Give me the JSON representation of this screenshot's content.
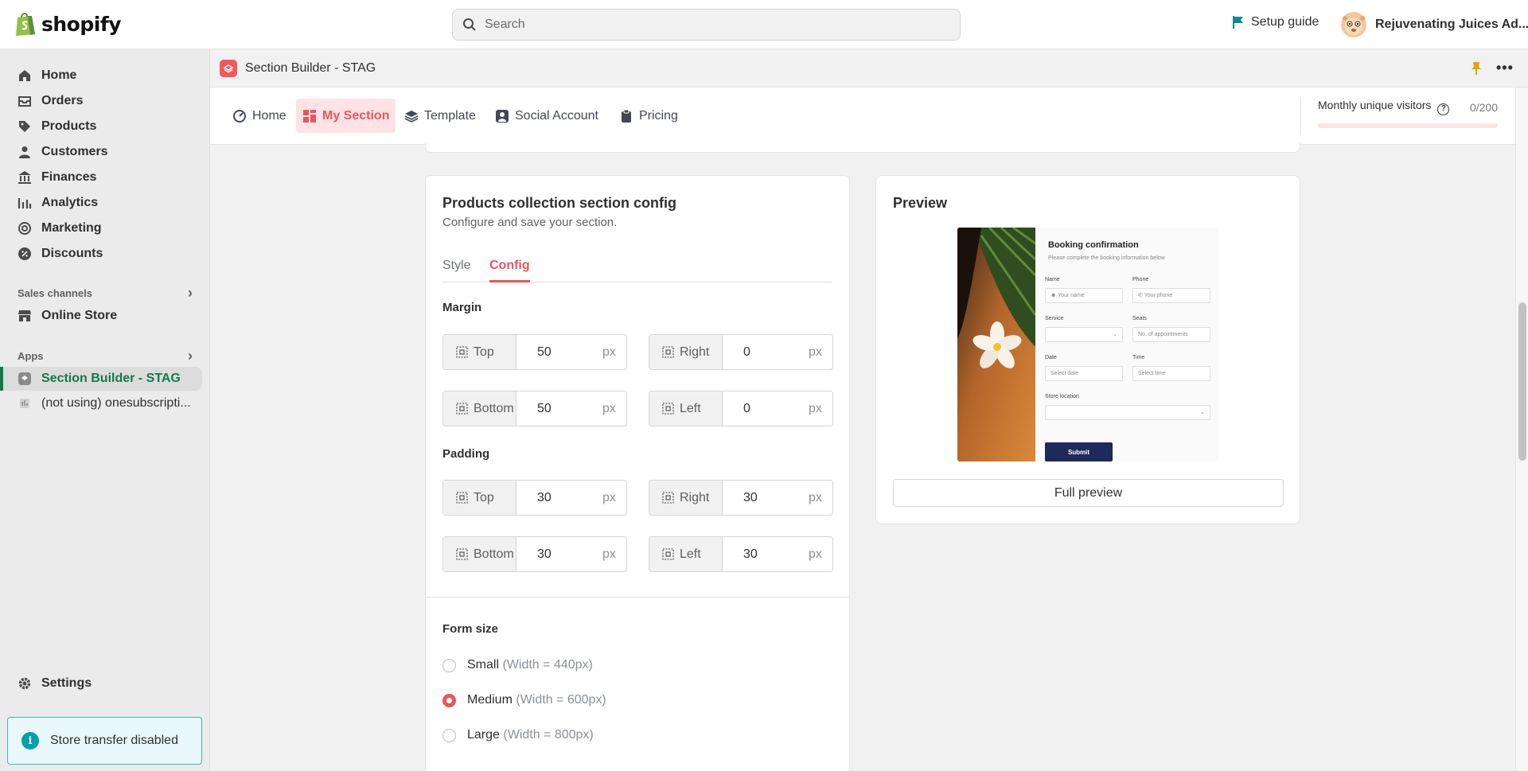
{
  "brand": {
    "name": "shopify",
    "color": "#5e8e3e"
  },
  "search": {
    "placeholder": "Search"
  },
  "header": {
    "setup_guide": "Setup guide",
    "account_name": "Rejuvenating Juices Ad..."
  },
  "sidebar": {
    "items": [
      {
        "label": "Home",
        "icon": "home-icon"
      },
      {
        "label": "Orders",
        "icon": "orders-icon"
      },
      {
        "label": "Products",
        "icon": "tag-icon"
      },
      {
        "label": "Customers",
        "icon": "person-icon"
      },
      {
        "label": "Finances",
        "icon": "bank-icon"
      },
      {
        "label": "Analytics",
        "icon": "chart-bars-icon"
      },
      {
        "label": "Marketing",
        "icon": "target-icon"
      },
      {
        "label": "Discounts",
        "icon": "discount-icon"
      }
    ],
    "sales_channels_label": "Sales channels",
    "online_store": "Online Store",
    "apps_label": "Apps",
    "apps": [
      {
        "label": "Section Builder - STAG"
      },
      {
        "label": "(not using) onesubscripti..."
      }
    ],
    "settings": "Settings",
    "transfer_notice": "Store transfer disabled",
    "active_color": "#107a4d"
  },
  "app_bar": {
    "title": "Section Builder - STAG"
  },
  "app_tabs": [
    {
      "label": "Home",
      "icon": "gauge-icon"
    },
    {
      "label": "My Section",
      "icon": "grid-icon"
    },
    {
      "label": "Template",
      "icon": "layers-icon"
    },
    {
      "label": "Social Account",
      "icon": "person-square-icon"
    },
    {
      "label": "Pricing",
      "icon": "clipboard-icon"
    }
  ],
  "visitors": {
    "label": "Monthly unique visitors",
    "count": "0/200",
    "fraction": 0
  },
  "config": {
    "title": "Products collection section config",
    "subtitle": "Configure and save your section.",
    "tabs": [
      "Style",
      "Config"
    ],
    "active_tab": "Config",
    "margin_label": "Margin",
    "padding_label": "Padding",
    "unit": "px",
    "margin": [
      {
        "side": "Top",
        "value": "50"
      },
      {
        "side": "Right",
        "value": "0"
      },
      {
        "side": "Bottom",
        "value": "50"
      },
      {
        "side": "Left",
        "value": "0"
      }
    ],
    "padding": [
      {
        "side": "Top",
        "value": "30"
      },
      {
        "side": "Right",
        "value": "30"
      },
      {
        "side": "Bottom",
        "value": "30"
      },
      {
        "side": "Left",
        "value": "30"
      }
    ],
    "form_size_label": "Form size",
    "form_sizes": [
      {
        "label": "Small",
        "hint": "(Width = 440px)",
        "checked": false
      },
      {
        "label": "Medium",
        "hint": "(Width = 600px)",
        "checked": true
      },
      {
        "label": "Large",
        "hint": "(Width = 800px)",
        "checked": false
      }
    ],
    "accent": "#e9555f"
  },
  "preview": {
    "title": "Preview",
    "form": {
      "title": "Booking confirmation",
      "subtitle": "Please complete the booking information below",
      "name_label": "Name",
      "name_placeholder": "Your name",
      "phone_label": "Phone",
      "phone_placeholder": "Your phone",
      "service_label": "Service",
      "seats_label": "Seats",
      "seats_placeholder": "No. of appointments",
      "date_label": "Date",
      "date_placeholder": "Select date",
      "time_label": "Time",
      "time_placeholder": "Select time",
      "location_label": "Store location",
      "submit": "Submit"
    },
    "full_preview_button": "Full preview"
  }
}
